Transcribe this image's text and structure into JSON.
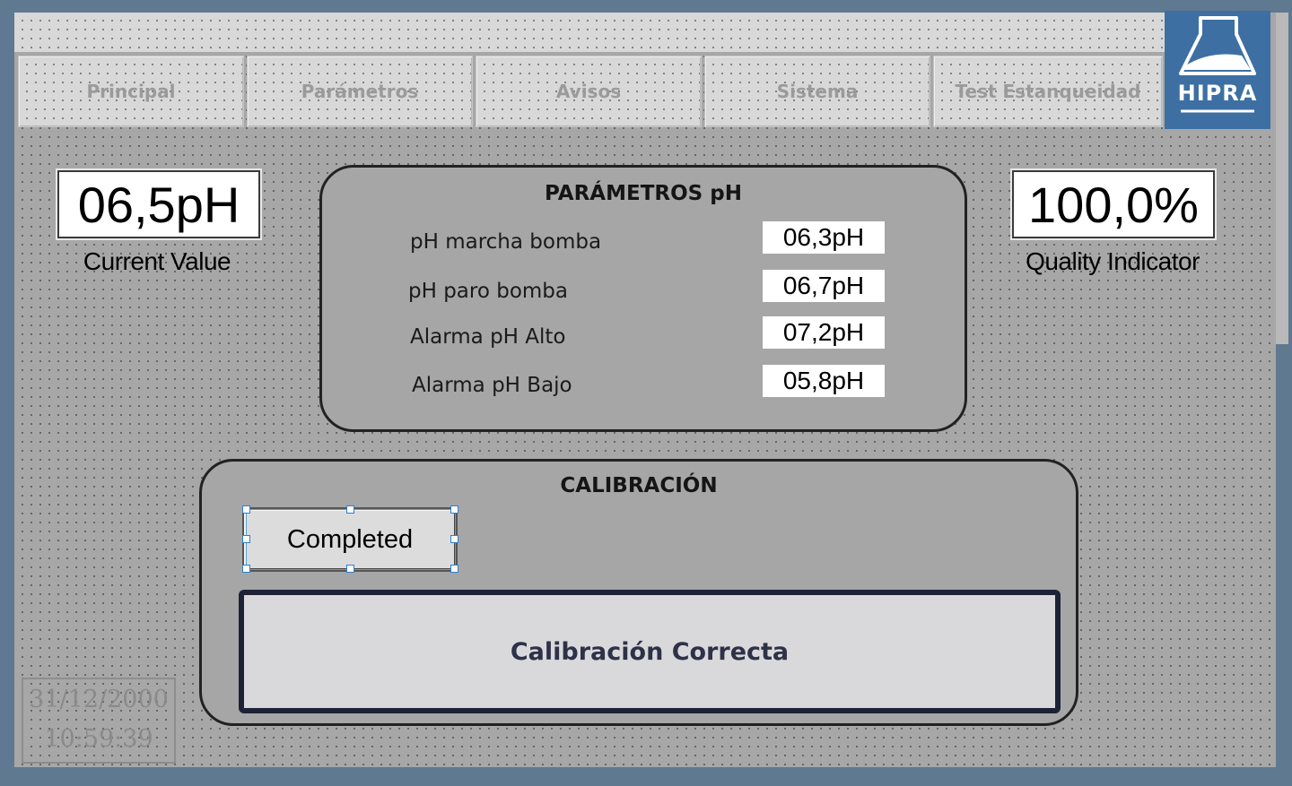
{
  "nav": {
    "items": [
      {
        "label": "Principal"
      },
      {
        "label": "Parámetros"
      },
      {
        "label": "Avisos"
      },
      {
        "label": "Sistema"
      },
      {
        "label": "Test Estanqueidad"
      }
    ]
  },
  "logo": {
    "text": "HIPRA"
  },
  "current": {
    "value": "06,5pH",
    "label": "Current Value"
  },
  "quality": {
    "value": "100,0%",
    "label": "Quality Indicator"
  },
  "params": {
    "title": "PARÁMETROS pH",
    "rows": [
      {
        "label": "pH marcha bomba",
        "value": "06,3pH"
      },
      {
        "label": "pH paro bomba",
        "value": "06,7pH"
      },
      {
        "label": "Alarma pH Alto",
        "value": "07,2pH"
      },
      {
        "label": "Alarma pH Bajo",
        "value": "05,8pH"
      }
    ]
  },
  "calibration": {
    "title": "CALIBRACIÓN",
    "button_label": "Completed",
    "status": "Calibración Correcta"
  },
  "clock": {
    "date": "31/12/2000",
    "time": "10:59:39"
  },
  "colors": {
    "frame": "#5f7990",
    "screen": "#a7a7a7",
    "logo_bg": "#3d6fa3",
    "status_border": "#1d2236"
  }
}
